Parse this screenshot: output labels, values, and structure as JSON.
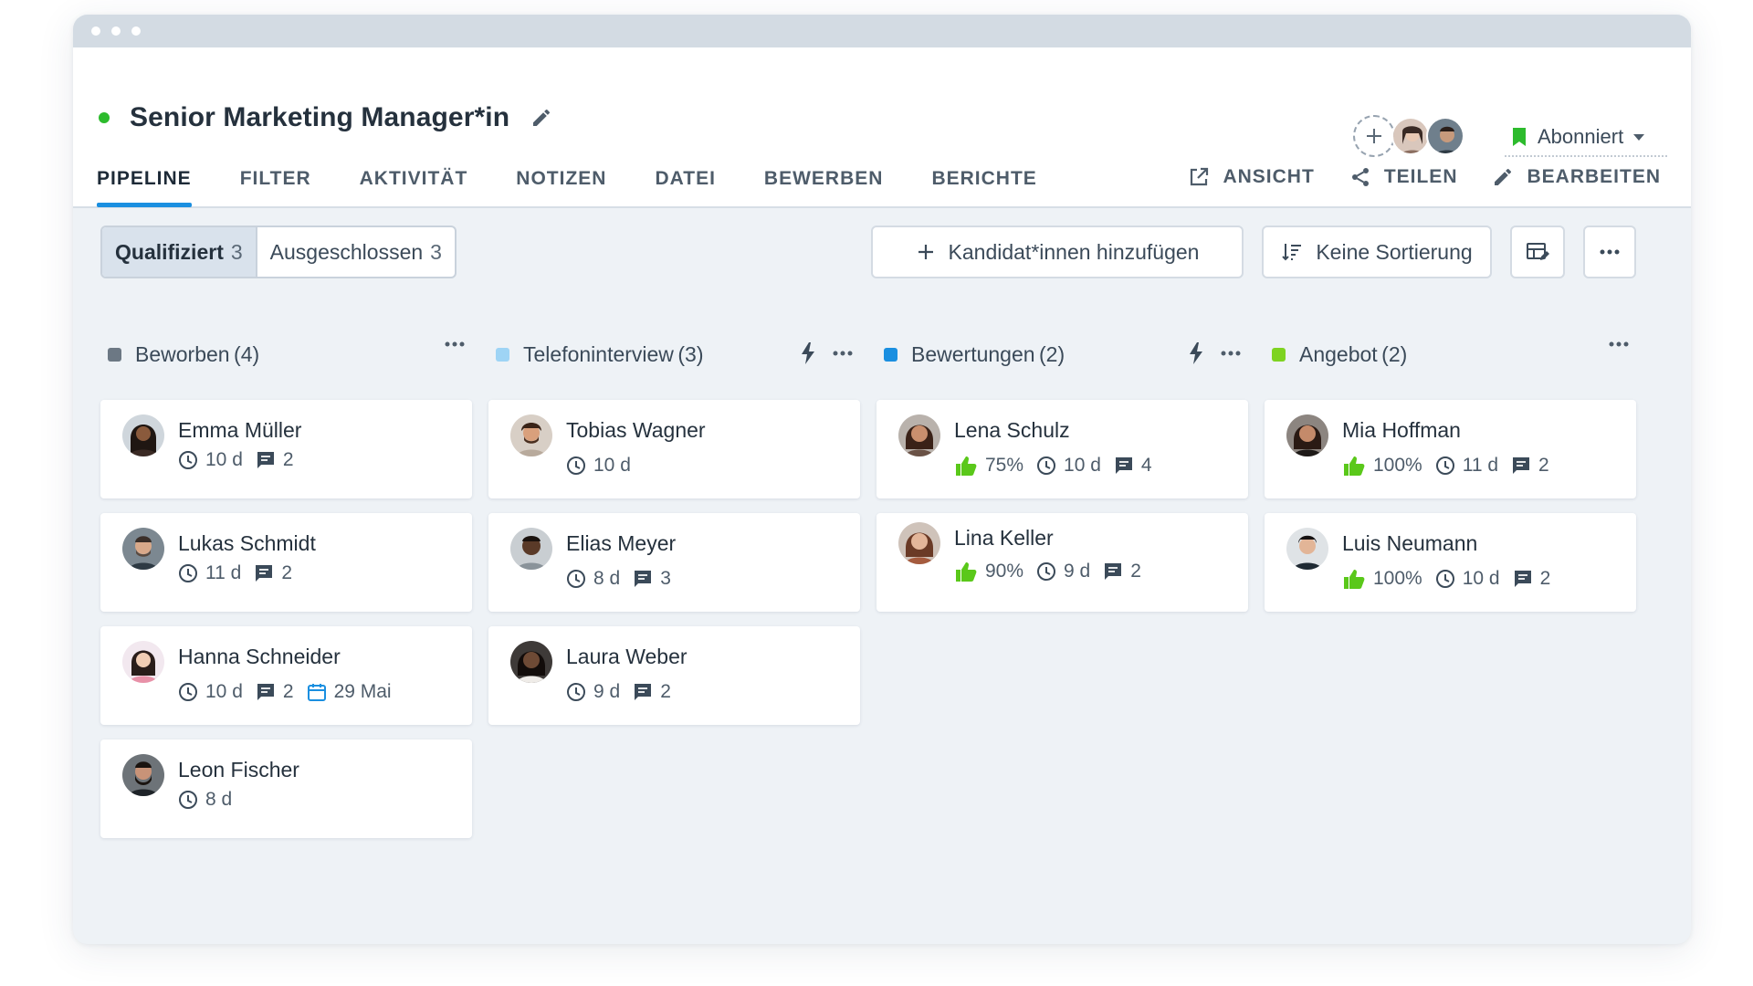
{
  "job": {
    "title": "Senior Marketing Manager*in",
    "status_color": "#2dbb2d"
  },
  "subscribe": {
    "label": "Abonniert",
    "color": "#2dbb2d"
  },
  "tabs": [
    {
      "label": "PIPELINE",
      "active": true
    },
    {
      "label": "FILTER"
    },
    {
      "label": "AKTIVITÄT"
    },
    {
      "label": "NOTIZEN"
    },
    {
      "label": "DATEI"
    },
    {
      "label": "BEWERBEN"
    },
    {
      "label": "BERICHTE"
    }
  ],
  "actions": {
    "view": "ANSICHT",
    "share": "TEILEN",
    "edit": "BEARBEITEN"
  },
  "toolbar": {
    "qualified_label": "Qualifiziert",
    "qualified_count": "3",
    "excluded_label": "Ausgeschlossen",
    "excluded_count": "3",
    "add_candidates": "Kandidat*innen hinzufügen",
    "sort": "Keine Sortierung"
  },
  "accent": "#1a8fe0",
  "columns": [
    {
      "title": "Beworben",
      "count": "(4)",
      "color": "#6c7884",
      "cards": [
        {
          "name": "Emma Müller",
          "time": "10 d",
          "comments": "2"
        },
        {
          "name": "Lukas Schmidt",
          "time": "11 d",
          "comments": "2"
        },
        {
          "name": "Hanna Schneider",
          "time": "10 d",
          "comments": "2",
          "date": "29 Mai"
        },
        {
          "name": "Leon Fischer",
          "time": "8 d"
        }
      ]
    },
    {
      "title": "Telefoninterview",
      "count": "(3)",
      "color": "#9ed4f5",
      "cards": [
        {
          "name": "Tobias Wagner",
          "time": "10 d"
        },
        {
          "name": "Elias Meyer",
          "time": "8 d",
          "comments": "3"
        },
        {
          "name": "Laura Weber",
          "time": "9 d",
          "comments": "2"
        }
      ]
    },
    {
      "title": "Bewertungen",
      "count": "(2)",
      "color": "#1a8fe0",
      "cards": [
        {
          "name": "Lena Schulz",
          "score": "75%",
          "time": "10 d",
          "comments": "4"
        },
        {
          "name": "Lina Keller",
          "score": "90%",
          "time": "9 d",
          "comments": "2"
        }
      ]
    },
    {
      "title": "Angebot",
      "count": "(2)",
      "color": "#7ed321",
      "cards": [
        {
          "name": "Mia Hoffman",
          "score": "100%",
          "time": "11 d",
          "comments": "2"
        },
        {
          "name": "Luis Neumann",
          "score": "100%",
          "time": "10 d",
          "comments": "2"
        }
      ]
    }
  ]
}
